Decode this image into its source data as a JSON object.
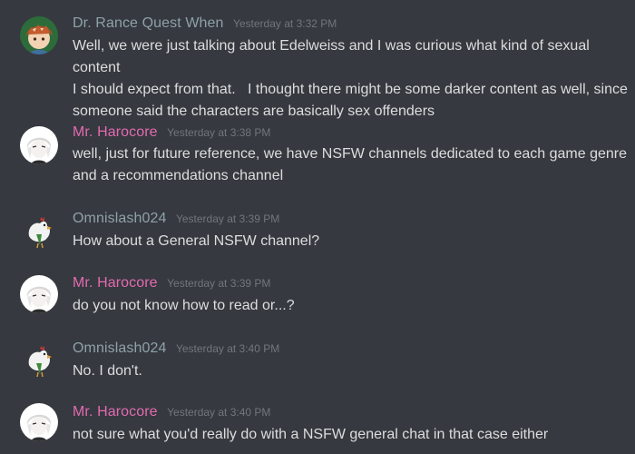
{
  "colors": {
    "background": "#36393f",
    "author_default": "#8ea1a8",
    "author_pink": "#e36ab2",
    "message_text": "#dcddde",
    "timestamp": "#72767d"
  },
  "messages": [
    {
      "author": "Dr. Rance Quest When",
      "timestamp": "Yesterday at 3:32 PM",
      "avatar": "anime-boy-avatar-icon",
      "text": "Well, we were just talking about Edelweiss and I was curious what kind of sexual content\nI should expect from that.   I thought there might be some darker content as well, since\nsomeone said the characters are basically sex offenders"
    },
    {
      "author": "Mr. Harocore",
      "timestamp": "Yesterday at 3:38 PM",
      "avatar": "white-haired-character-avatar-icon",
      "text": "well, just for future reference, we have NSFW channels dedicated to each game genre\nand a recommendations channel"
    },
    {
      "author": "Omnislash024",
      "timestamp": "Yesterday at 3:39 PM",
      "avatar": "chicken-avatar-icon",
      "text": "How about a General NSFW channel?"
    },
    {
      "author": "Mr. Harocore",
      "timestamp": "Yesterday at 3:39 PM",
      "avatar": "white-haired-character-avatar-icon",
      "text": "do you not know how to read or...?"
    },
    {
      "author": "Omnislash024",
      "timestamp": "Yesterday at 3:40 PM",
      "avatar": "chicken-avatar-icon",
      "text": "No. I don't."
    },
    {
      "author": "Mr. Harocore",
      "timestamp": "Yesterday at 3:40 PM",
      "avatar": "white-haired-character-avatar-icon",
      "text": "not sure what you'd really do with a NSFW general chat in that case either"
    }
  ]
}
